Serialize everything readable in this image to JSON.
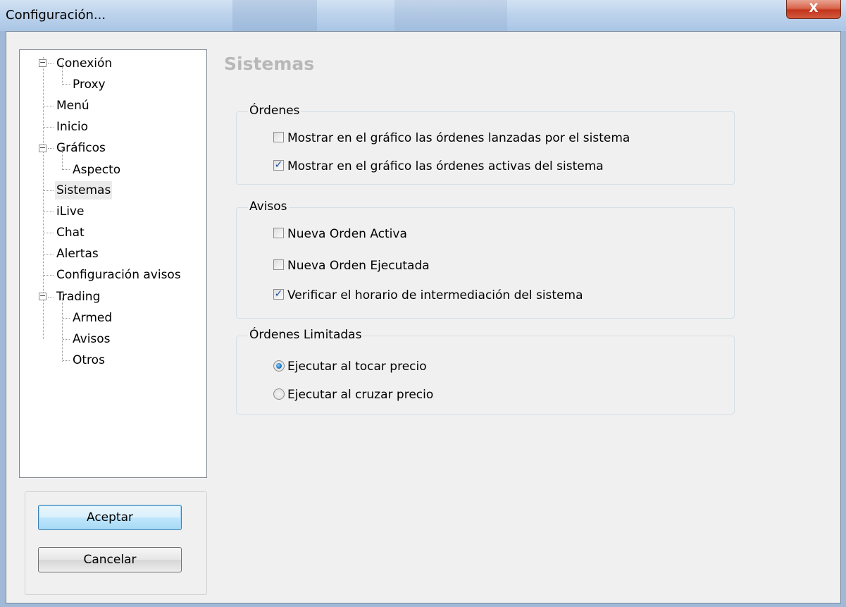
{
  "window": {
    "title": "Configuración...",
    "close_label": "X"
  },
  "tree": {
    "items": [
      {
        "label": "Conexión"
      },
      {
        "label": "Proxy"
      },
      {
        "label": "Menú"
      },
      {
        "label": "Inicio"
      },
      {
        "label": "Gráficos"
      },
      {
        "label": "Aspecto"
      },
      {
        "label": "Sistemas",
        "selected": true
      },
      {
        "label": "iLive"
      },
      {
        "label": "Chat"
      },
      {
        "label": "Alertas"
      },
      {
        "label": "Configuración avisos"
      },
      {
        "label": "Trading"
      },
      {
        "label": "Armed"
      },
      {
        "label": "Avisos"
      },
      {
        "label": "Otros"
      }
    ],
    "expander_symbol": "−"
  },
  "buttons": {
    "accept_label": "Aceptar",
    "cancel_label": "Cancelar"
  },
  "panel": {
    "heading": "Sistemas",
    "ordenes": {
      "legend": "Órdenes",
      "opt1": {
        "label": "Mostrar en el gráfico las órdenes lanzadas por el sistema",
        "checked": false
      },
      "opt2": {
        "label": "Mostrar en el gráfico las órdenes activas del sistema",
        "checked": true
      }
    },
    "avisos": {
      "legend": "Avisos",
      "opt1": {
        "label": "Nueva Orden Activa",
        "checked": false
      },
      "opt2": {
        "label": "Nueva Orden Ejecutada",
        "checked": false
      },
      "opt3": {
        "label": "Verificar el horario de intermediación del sistema",
        "checked": true
      }
    },
    "limitadas": {
      "legend": "Órdenes Limitadas",
      "opt1": {
        "label": "Ejecutar al tocar precio",
        "selected": true
      },
      "opt2": {
        "label": "Ejecutar al cruzar precio",
        "selected": false
      }
    }
  },
  "colors": {
    "accent": "#1b78c9",
    "heading": "#b8b8b8"
  },
  "check_mark": "✓"
}
